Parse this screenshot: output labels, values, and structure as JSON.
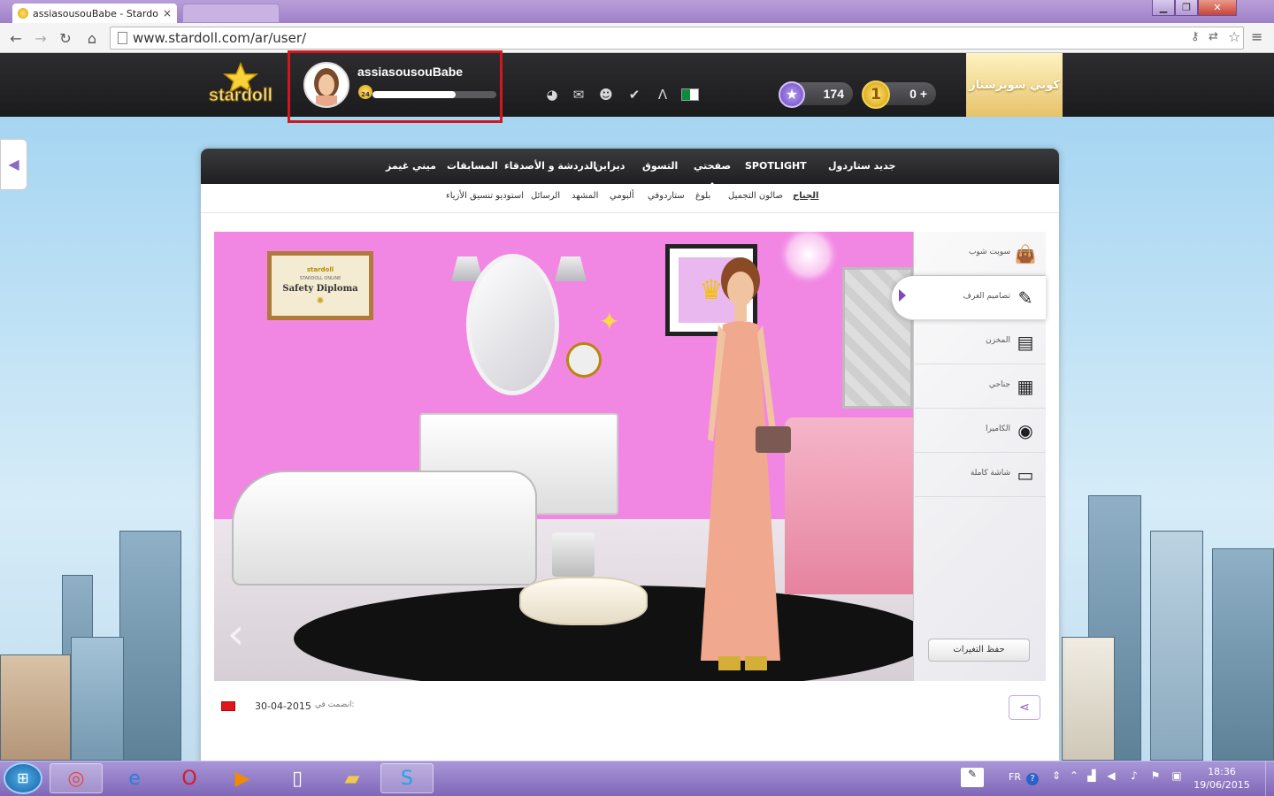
{
  "browser": {
    "tab_title": "assiasousouBabe - Stardo",
    "tab_close": "×",
    "url": "www.stardoll.com/ar/user/",
    "window_buttons": [
      "▁",
      "❐",
      "✕"
    ],
    "nav_icons": [
      "back-icon",
      "forward-icon",
      "reload-icon",
      "home-icon"
    ]
  },
  "header": {
    "logo_text": "stardoll",
    "username": "assiasousouBabe",
    "level": "24",
    "xp_progress": 0.67,
    "stardollars": "174",
    "coins": "0 +",
    "superstar_label": "كوني سوبرستار"
  },
  "main_nav": [
    {
      "label": "جديد ستاردول",
      "active": false
    },
    {
      "label": "SPOTLIGHT",
      "active": false
    },
    {
      "label": "صفحتي",
      "active": true
    },
    {
      "label": "التسوق",
      "active": false
    },
    {
      "label": "ديزاين",
      "active": false
    },
    {
      "label": "الدردشة و الأصدقاء",
      "active": false
    },
    {
      "label": "المسابقات",
      "active": false
    },
    {
      "label": "ميني غيمز",
      "active": false
    }
  ],
  "sub_nav": [
    {
      "label": "الجناح",
      "active": true
    },
    {
      "label": "صالون التجميل",
      "active": false
    },
    {
      "label": "بلوغ",
      "active": false
    },
    {
      "label": "ستاردوفي",
      "active": false
    },
    {
      "label": "ألبومي",
      "active": false
    },
    {
      "label": "المشهد",
      "active": false
    },
    {
      "label": "الرسائل",
      "active": false
    },
    {
      "label": "استوديو تنسيق الأزياء",
      "active": false
    }
  ],
  "room": {
    "diploma_brand": "stardoll",
    "diploma_sub": "STARDOLL ONLINE",
    "diploma_title": "Safety Diploma"
  },
  "right_menu": [
    {
      "label": "سويت شوب",
      "icon": "shopping-bag-icon",
      "active": false
    },
    {
      "label": "تصاميم الغرف",
      "icon": "design-tool-icon",
      "active": true
    },
    {
      "label": "المخزن",
      "icon": "dresser-icon",
      "active": false
    },
    {
      "label": "جناحي",
      "icon": "room-icon",
      "active": false
    },
    {
      "label": "الكاميرا",
      "icon": "camera-icon",
      "active": false
    },
    {
      "label": "شاشة كاملة",
      "icon": "fullscreen-icon",
      "active": false
    }
  ],
  "save_button": "حفظ التغيرات",
  "profile_info": {
    "joined_label": "انضمت في:",
    "joined_date": "30-04-2015"
  },
  "taskbar": {
    "lang": "FR",
    "time": "18:36",
    "date": "19/06/2015",
    "apps": [
      "chrome-icon",
      "internet-explorer-icon",
      "opera-icon",
      "media-player-icon",
      "document-icon",
      "folder-icon",
      "skype-icon"
    ]
  },
  "colors": {
    "highlight_border": "#d3171d",
    "room_wall": "#f286e3",
    "accent_purple": "#8a57c8"
  }
}
